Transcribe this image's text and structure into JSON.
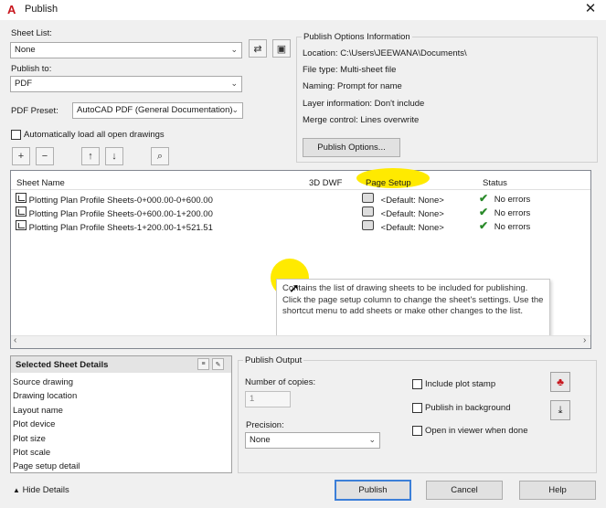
{
  "window": {
    "title": "Publish",
    "close_glyph": "✕"
  },
  "sheet_list": {
    "label": "Sheet List:",
    "value": "None"
  },
  "publish_to": {
    "label": "Publish to:",
    "value": "PDF"
  },
  "pdf_preset": {
    "label": "PDF Preset:",
    "value": "AutoCAD PDF (General Documentation)"
  },
  "auto_load": {
    "label": "Automatically load all open drawings",
    "checked": false
  },
  "publish_info": {
    "title": "Publish Options Information",
    "lines": [
      "Location:  C:\\Users\\JEEWANA\\Documents\\",
      "File type: Multi-sheet file",
      "Naming: Prompt for name",
      "Layer information: Don't include",
      "Merge control: Lines overwrite"
    ],
    "button": "Publish Options..."
  },
  "sheet_table": {
    "headers": [
      "Sheet Name",
      "3D DWF",
      "Page Setup",
      "Status"
    ],
    "rows": [
      {
        "name": "Plotting Plan Profile Sheets-0+000.00-0+600.00",
        "page_setup": "<Default: None>",
        "status": "No errors"
      },
      {
        "name": "Plotting Plan Profile Sheets-0+600.00-1+200.00",
        "page_setup": "<Default: None>",
        "status": "No errors"
      },
      {
        "name": "Plotting Plan Profile Sheets-1+200.00-1+521.51",
        "page_setup": "<Default: None>",
        "status": "No errors"
      }
    ],
    "tooltip": "Contains the list of drawing sheets to be included for publishing. Click the page setup column to change the sheet's settings. Use the shortcut menu to add sheets or make other changes to the list."
  },
  "details": {
    "title": "Selected Sheet Details",
    "items": [
      "Source drawing",
      "Drawing location",
      "Layout name",
      "Plot device",
      "Plot size",
      "Plot scale",
      "Page setup detail"
    ]
  },
  "publish_output": {
    "title": "Publish Output",
    "copies_label": "Number of copies:",
    "copies_value": "1",
    "precision_label": "Precision:",
    "precision_value": "None",
    "include_stamp": "Include plot stamp",
    "in_background": "Publish in background",
    "open_viewer": "Open in viewer when done"
  },
  "footer": {
    "hide_details": "Hide Details",
    "publish": "Publish",
    "cancel": "Cancel",
    "help": "Help"
  },
  "colors": {
    "highlight": "#ffea00",
    "check": "#2a8a2a",
    "accent": "#3c7fd8",
    "brand": "#c8161d"
  }
}
